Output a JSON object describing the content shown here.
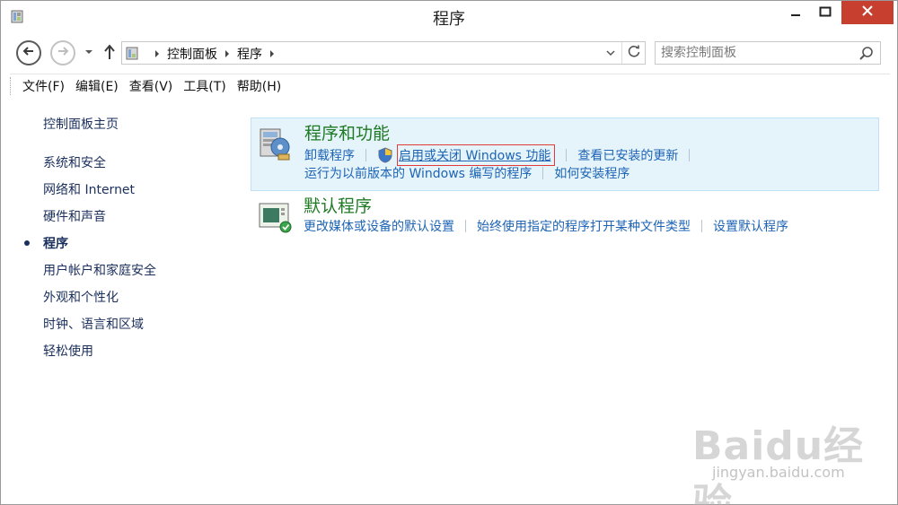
{
  "window": {
    "title": "程序",
    "icons": {
      "app": "control-panel-icon",
      "minimize": "minimize-icon",
      "maximize": "maximize-icon",
      "close": "close-icon"
    }
  },
  "navigation": {
    "breadcrumbs": [
      "控制面板",
      "程序"
    ],
    "search_placeholder": "搜索控制面板",
    "icons": {
      "back": "back-arrow-icon",
      "forward": "forward-arrow-icon",
      "recent": "chevron-down-icon",
      "up": "up-arrow-icon",
      "refresh": "refresh-icon",
      "search": "search-icon"
    }
  },
  "menubar": {
    "items": [
      "文件(F)",
      "编辑(E)",
      "查看(V)",
      "工具(T)",
      "帮助(H)"
    ]
  },
  "sidebar": {
    "home": "控制面板主页",
    "items": [
      {
        "label": "系统和安全",
        "current": false
      },
      {
        "label": "网络和 Internet",
        "current": false
      },
      {
        "label": "硬件和声音",
        "current": false
      },
      {
        "label": "程序",
        "current": true
      },
      {
        "label": "用户帐户和家庭安全",
        "current": false
      },
      {
        "label": "外观和个性化",
        "current": false
      },
      {
        "label": "时钟、语言和区域",
        "current": false
      },
      {
        "label": "轻松使用",
        "current": false
      }
    ]
  },
  "categories": [
    {
      "title": "程序和功能",
      "icon": "programs-features-icon",
      "highlighted_bg": "#e5f3fb",
      "tasks_row1": [
        "卸载程序",
        "启用或关闭 Windows 功能",
        "查看已安装的更新"
      ],
      "tasks_row2": [
        "运行为以前版本的 Windows 编写的程序",
        "如何安装程序"
      ]
    },
    {
      "title": "默认程序",
      "icon": "default-programs-icon",
      "tasks_row1": [
        "更改媒体或设备的默认设置",
        "始终使用指定的程序打开某种文件类型",
        "设置默认程序"
      ]
    }
  ],
  "watermark": {
    "brand": "Baidu经验",
    "url": "jingyan.baidu.com"
  },
  "colors": {
    "link": "#1d64b5",
    "category_title": "#1e7a23",
    "close_button": "#c7402f",
    "highlight_box": "#e23a3a",
    "sidebar_link": "#1a2f5c"
  }
}
